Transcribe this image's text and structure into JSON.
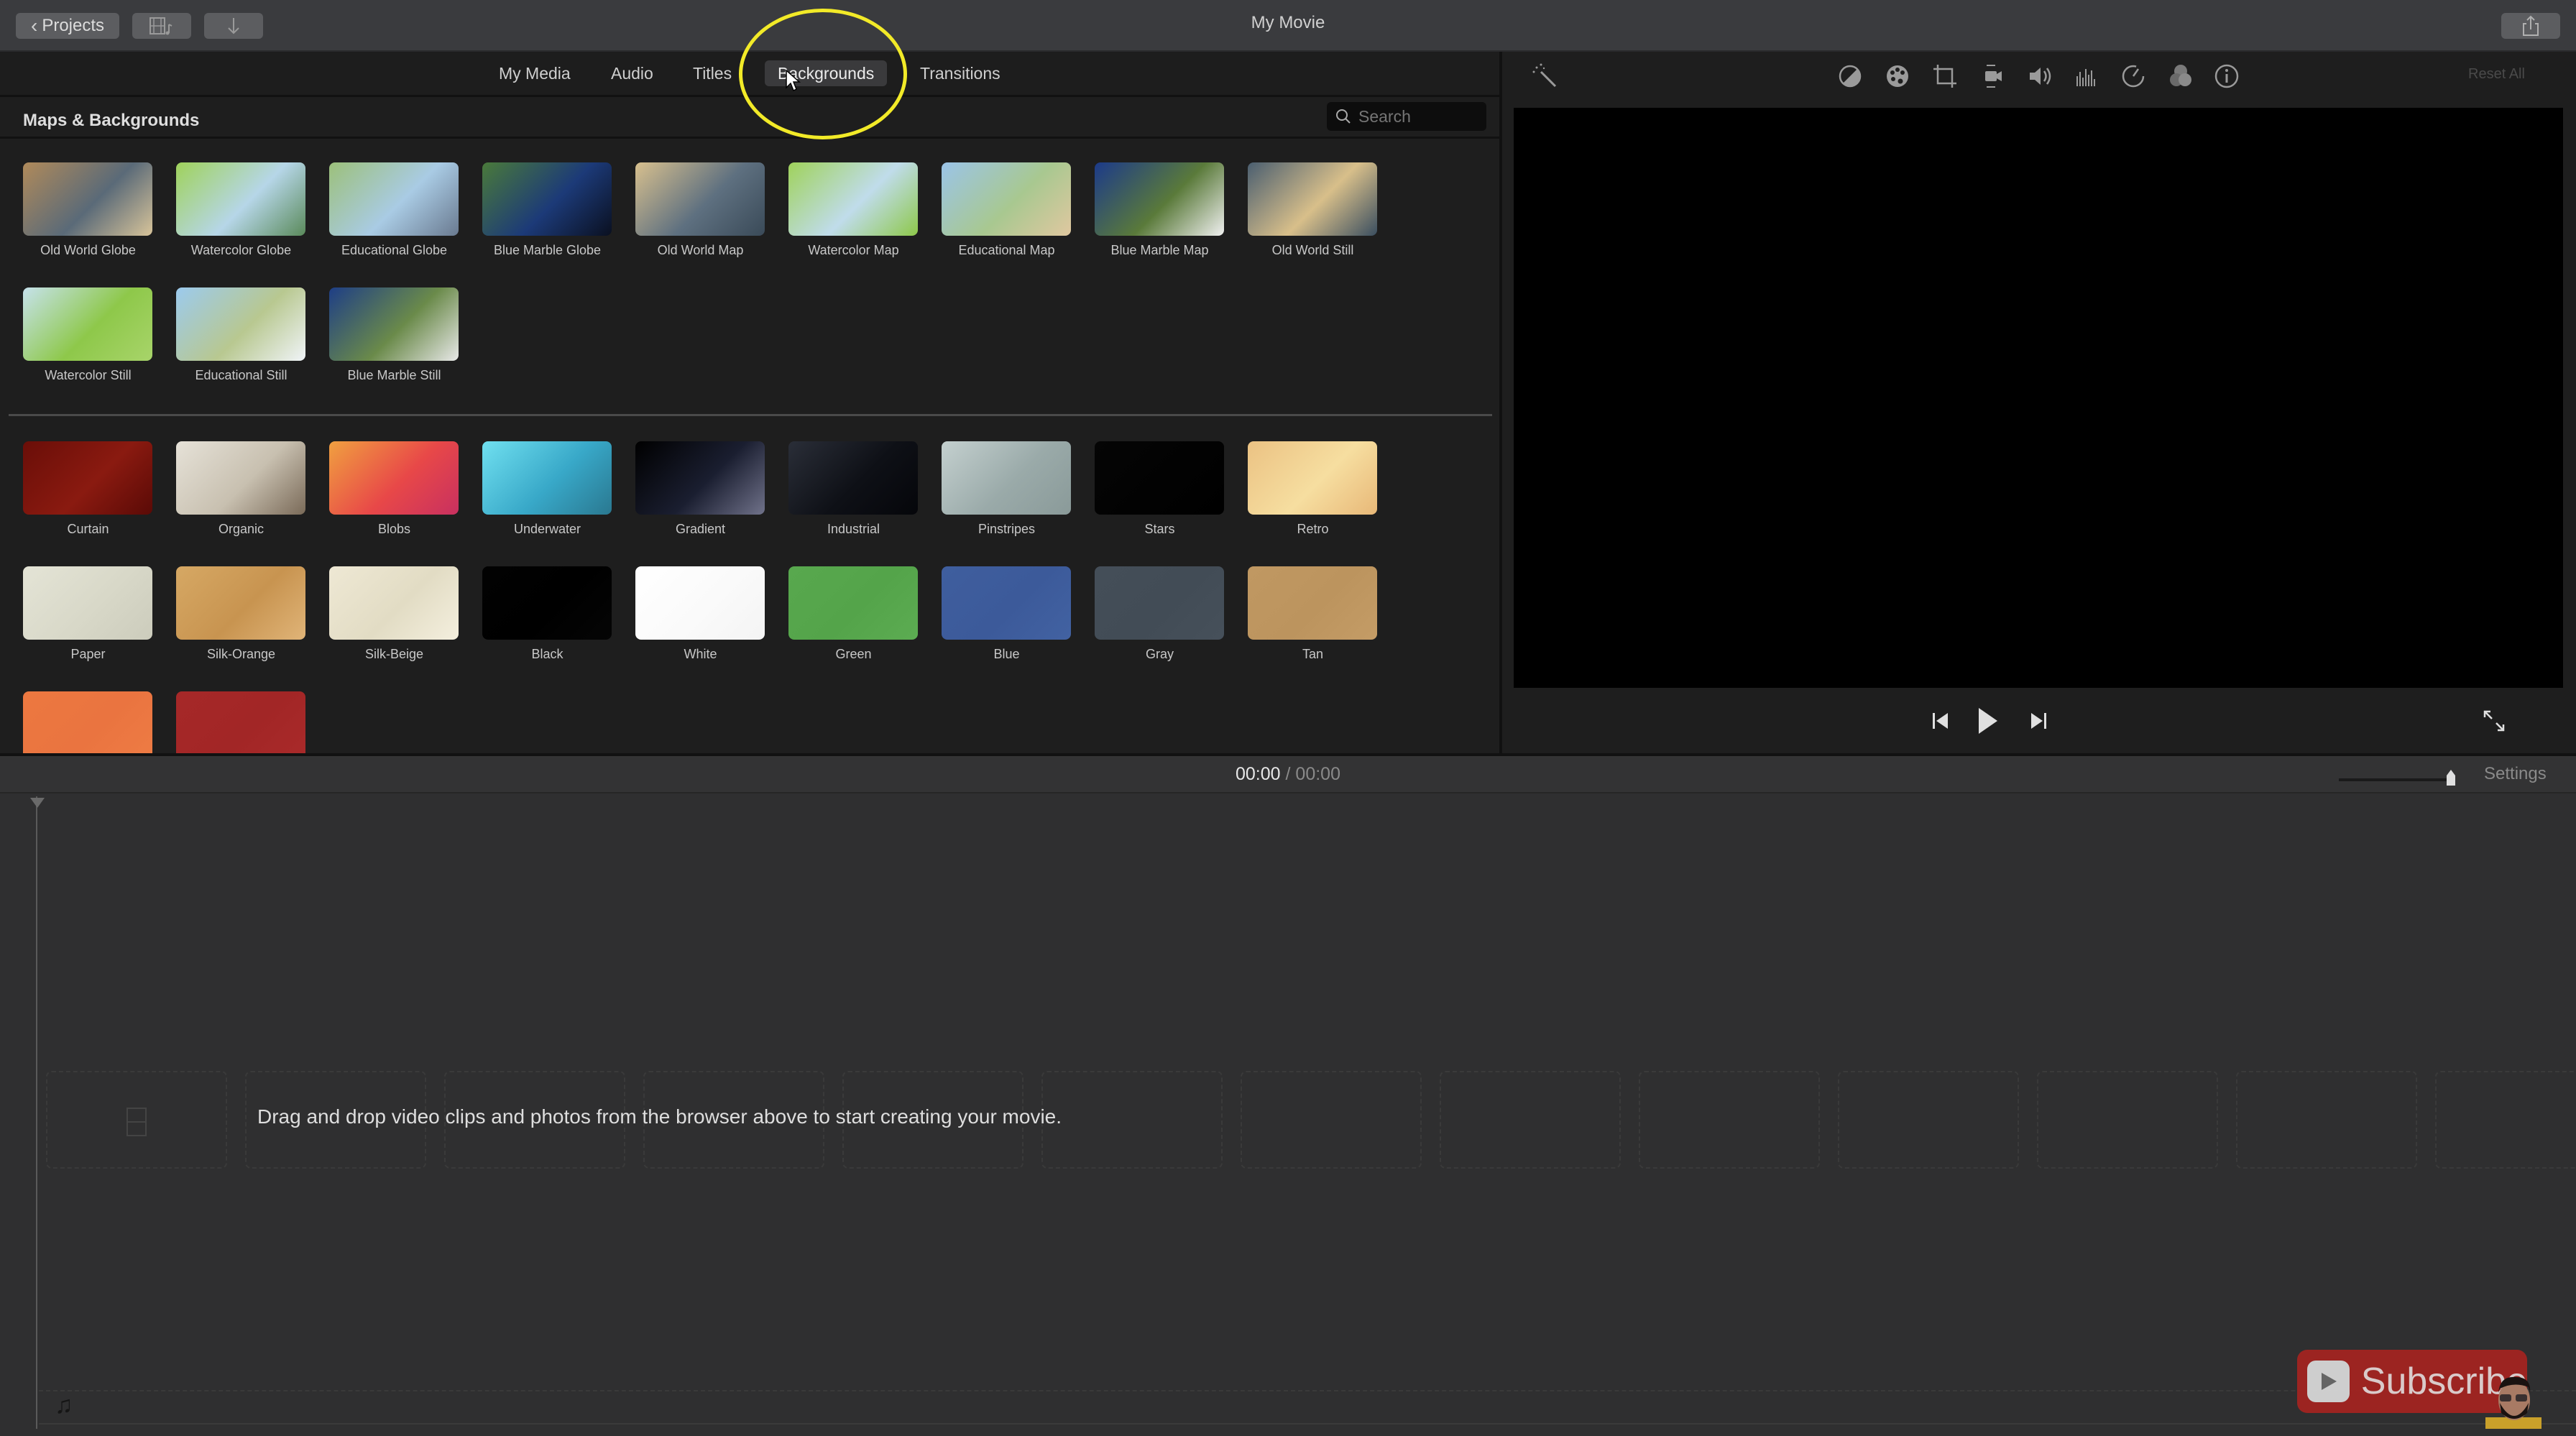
{
  "window": {
    "title": "My Movie"
  },
  "titlebar": {
    "projects_label": "Projects",
    "media_button_icon": "film-music-icon",
    "import_button_icon": "download-arrow-icon",
    "share_button_icon": "share-icon"
  },
  "browser": {
    "tabs": [
      {
        "label": "My Media",
        "active": false
      },
      {
        "label": "Audio",
        "active": false
      },
      {
        "label": "Titles",
        "active": false
      },
      {
        "label": "Backgrounds",
        "active": true
      },
      {
        "label": "Transitions",
        "active": false
      }
    ],
    "section_title": "Maps & Backgrounds",
    "search": {
      "placeholder": "Search",
      "value": ""
    },
    "maps": [
      {
        "label": "Old World Globe",
        "colors": [
          "#b08a5a",
          "#5a6a78",
          "#d8c49a"
        ]
      },
      {
        "label": "Watercolor Globe",
        "colors": [
          "#9fd25a",
          "#b6d6e8",
          "#5a8a5a"
        ]
      },
      {
        "label": "Educational Globe",
        "colors": [
          "#9cc07a",
          "#a9cbe4",
          "#6a7a90"
        ]
      },
      {
        "label": "Blue Marble Globe",
        "colors": [
          "#4a7a3a",
          "#1c3a78",
          "#0a1020"
        ]
      },
      {
        "label": "Old World Map",
        "colors": [
          "#d8c08e",
          "#5e7080",
          "#3a4a58"
        ]
      },
      {
        "label": "Watercolor Map",
        "colors": [
          "#9fd25a",
          "#c0dceb",
          "#8ec84a"
        ]
      },
      {
        "label": "Educational Map",
        "colors": [
          "#9bc4e8",
          "#a8c890",
          "#e0c8a0"
        ]
      },
      {
        "label": "Blue Marble Map",
        "colors": [
          "#1c3a8a",
          "#5a7a3a",
          "#f0f0f0"
        ]
      },
      {
        "label": "Old World Still",
        "colors": [
          "#4a5e70",
          "#d8bf8a",
          "#3a4e60"
        ]
      },
      {
        "label": "Watercolor Still",
        "colors": [
          "#c6e2ec",
          "#8ec84a",
          "#a8d46a"
        ]
      },
      {
        "label": "Educational Still",
        "colors": [
          "#9ccaee",
          "#b8c890",
          "#f0f4f8"
        ]
      },
      {
        "label": "Blue Marble Still",
        "colors": [
          "#1e3e86",
          "#6a8a4a",
          "#e8e8e8"
        ]
      }
    ],
    "backgrounds": [
      {
        "label": "Curtain",
        "colors": [
          "#6a0e08",
          "#8a1a10",
          "#5a0a06"
        ]
      },
      {
        "label": "Organic",
        "colors": [
          "#e6e2d8",
          "#c8c0b0",
          "#7a6a58"
        ]
      },
      {
        "label": "Blobs",
        "colors": [
          "#f0a040",
          "#e84848",
          "#c83060"
        ]
      },
      {
        "label": "Underwater",
        "colors": [
          "#70e0f0",
          "#38a8c8",
          "#2a7890"
        ]
      },
      {
        "label": "Gradient",
        "colors": [
          "#000000",
          "#1a1e30",
          "#70728a"
        ]
      },
      {
        "label": "Industrial",
        "colors": [
          "#2a2e38",
          "#0e1016",
          "#05060a"
        ]
      },
      {
        "label": "Pinstripes",
        "colors": [
          "#c4d0cf",
          "#9aaaa9",
          "#8a9a99"
        ]
      },
      {
        "label": "Stars",
        "colors": [
          "#050505",
          "#020202",
          "#000000"
        ]
      },
      {
        "label": "Retro",
        "colors": [
          "#ebc283",
          "#f6dea0",
          "#e8b878"
        ]
      },
      {
        "label": "Paper",
        "colors": [
          "#e4e4d6",
          "#d8d8c8",
          "#ccccbc"
        ]
      },
      {
        "label": "Silk-Orange",
        "colors": [
          "#d6a864",
          "#c89450",
          "#e0b478"
        ]
      },
      {
        "label": "Silk-Beige",
        "colors": [
          "#eee8d4",
          "#e2dcc4",
          "#f4efde"
        ]
      },
      {
        "label": "Black",
        "colors": [
          "#020202",
          "#000000",
          "#050505"
        ]
      },
      {
        "label": "White",
        "colors": [
          "#ffffff",
          "#fafafa",
          "#f4f4f4"
        ]
      },
      {
        "label": "Green",
        "colors": [
          "#58a84e",
          "#54a44a",
          "#5cac52"
        ]
      },
      {
        "label": "Blue",
        "colors": [
          "#3f5e9e",
          "#3c5a9a",
          "#4262a2"
        ]
      },
      {
        "label": "Gray",
        "colors": [
          "#444e58",
          "#424c56",
          "#46505a"
        ]
      },
      {
        "label": "Tan",
        "colors": [
          "#c09862",
          "#bc945e",
          "#c49c66"
        ]
      },
      {
        "label": "",
        "colors": [
          "#ec7840",
          "#ea7440",
          "#ee7c44"
        ]
      },
      {
        "label": "",
        "colors": [
          "#a62828",
          "#a22626",
          "#aa2a2a"
        ]
      }
    ]
  },
  "viewer": {
    "toolbar_icons": [
      "magic-wand-icon",
      "color-balance-icon",
      "color-correction-icon",
      "crop-icon",
      "stabilization-icon",
      "volume-icon",
      "noise-reduction-icon",
      "speed-icon",
      "clip-filter-icon",
      "info-icon"
    ],
    "reset_all_label": "Reset All",
    "controls": {
      "previous_icon": "skip-back-icon",
      "play_icon": "play-icon",
      "next_icon": "skip-forward-icon",
      "fullscreen_icon": "fullscreen-icon"
    }
  },
  "timeline": {
    "timecode_current": "00:00",
    "timecode_separator": "/",
    "timecode_total": "00:00",
    "zoom_level": 1.0,
    "settings_label": "Settings",
    "empty_message": "Drag and drop video clips and photos from the browser above to start creating your movie."
  },
  "overlay": {
    "subscribe_label": "Subscribe",
    "highlight_color": "#f2ea28"
  }
}
